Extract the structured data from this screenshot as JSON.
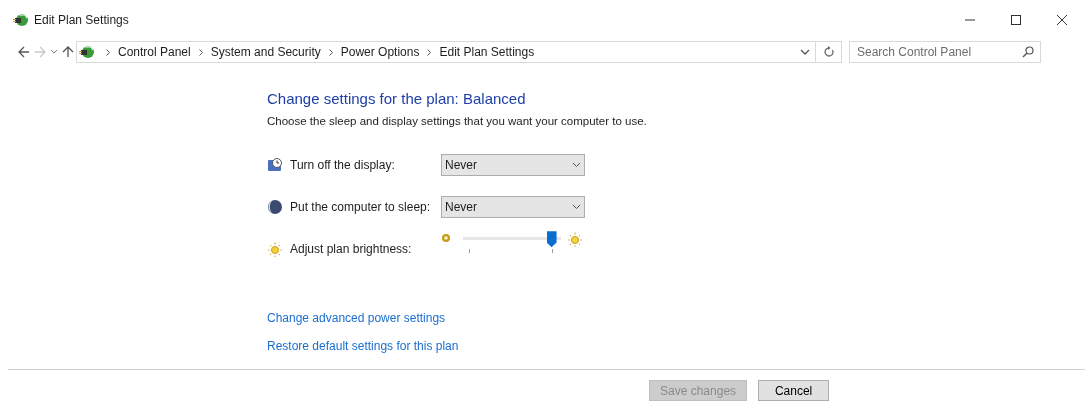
{
  "window": {
    "title": "Edit Plan Settings"
  },
  "nav": {
    "back_disabled": false,
    "forward_disabled": true
  },
  "breadcrumb": [
    "Control Panel",
    "System and Security",
    "Power Options",
    "Edit Plan Settings"
  ],
  "search": {
    "placeholder": "Search Control Panel"
  },
  "heading": "Change settings for the plan: Balanced",
  "subtitle": "Choose the sleep and display settings that you want your computer to use.",
  "settings": [
    {
      "kind": "dropdown",
      "label": "Turn off the display:",
      "value": "Never"
    },
    {
      "kind": "dropdown",
      "label": "Put the computer to sleep:",
      "value": "Never"
    },
    {
      "kind": "slider",
      "label": "Adjust plan brightness:",
      "level": 0.95
    }
  ],
  "links": [
    "Change advanced power settings",
    "Restore default settings for this plan"
  ],
  "buttons": [
    {
      "label": "Save changes",
      "disabled": true
    },
    {
      "label": "Cancel",
      "disabled": false
    }
  ]
}
